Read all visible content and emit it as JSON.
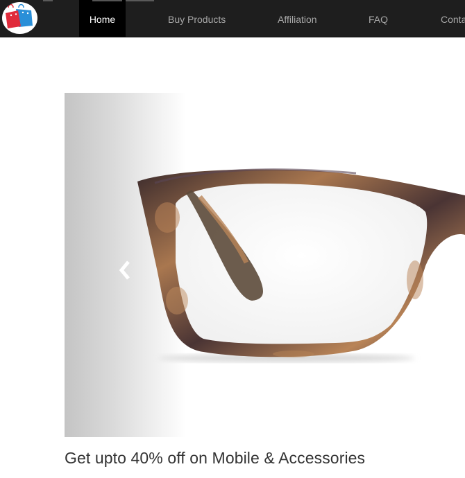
{
  "header": {
    "logo_icon": "shopping-bags-icon",
    "nav": [
      {
        "label": "Home",
        "active": true
      },
      {
        "label": "Buy Products",
        "active": false
      },
      {
        "label": "Affiliation",
        "active": false
      },
      {
        "label": "FAQ",
        "active": false
      },
      {
        "label": "Contact",
        "active": false
      }
    ]
  },
  "slider": {
    "slide_image": "eyeglasses-product-image",
    "prev_icon": "chevron-left-icon",
    "caption": "Get upto 40% off on Mobile & Accessories"
  },
  "colors": {
    "navbar_bg": "#1e1e1e",
    "nav_active_bg": "#000000",
    "nav_text": "#a8a8a8",
    "nav_active_text": "#ffffff",
    "bag_red": "#e02b3b",
    "bag_blue": "#2a8fd8",
    "frame_dark": "#3b2a34",
    "frame_tortoise": "#b98457"
  }
}
